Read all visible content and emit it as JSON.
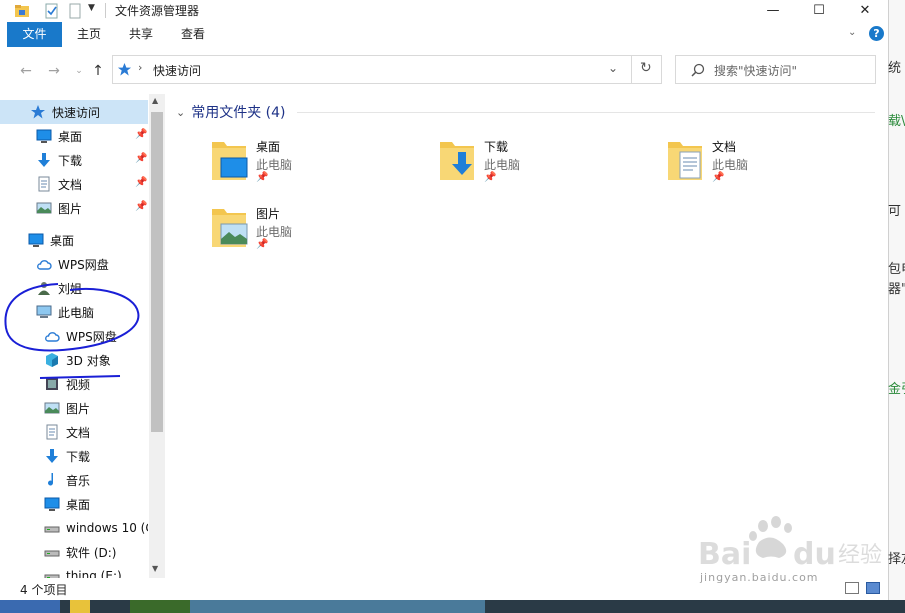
{
  "window": {
    "title": "文件资源管理器"
  },
  "ribbon": {
    "tabs": [
      "文件",
      "主页",
      "共享",
      "查看"
    ]
  },
  "address": {
    "location": "快速访问",
    "search_placeholder": "搜索\"快速访问\""
  },
  "nav": {
    "items": [
      {
        "label": "快速访问",
        "icon": "star-icon",
        "pinned": false
      },
      {
        "label": "桌面",
        "icon": "desktop-icon",
        "pinned": true
      },
      {
        "label": "下载",
        "icon": "download-icon",
        "pinned": true
      },
      {
        "label": "文档",
        "icon": "document-icon",
        "pinned": true
      },
      {
        "label": "图片",
        "icon": "picture-icon",
        "pinned": true
      },
      {
        "label": "桌面",
        "icon": "desktop-icon",
        "pinned": false
      },
      {
        "label": "WPS网盘",
        "icon": "cloud-icon",
        "pinned": false
      },
      {
        "label": "刘姐",
        "icon": "user-icon",
        "pinned": false
      },
      {
        "label": "此电脑",
        "icon": "computer-icon",
        "pinned": false
      },
      {
        "label": "WPS网盘",
        "icon": "cloud-icon",
        "pinned": false
      },
      {
        "label": "3D 对象",
        "icon": "cube-icon",
        "pinned": false
      },
      {
        "label": "视频",
        "icon": "video-icon",
        "pinned": false
      },
      {
        "label": "图片",
        "icon": "picture-icon",
        "pinned": false
      },
      {
        "label": "文档",
        "icon": "document-icon",
        "pinned": false
      },
      {
        "label": "下载",
        "icon": "download-icon",
        "pinned": false
      },
      {
        "label": "音乐",
        "icon": "music-icon",
        "pinned": false
      },
      {
        "label": "桌面",
        "icon": "desktop-icon",
        "pinned": false
      },
      {
        "label": "windows 10 (C",
        "icon": "drive-icon",
        "pinned": false
      },
      {
        "label": "软件 (D:)",
        "icon": "drive-icon",
        "pinned": false
      },
      {
        "label": "thing (E:)",
        "icon": "drive-icon",
        "pinned": false
      }
    ]
  },
  "content": {
    "group_title": "常用文件夹 (4)",
    "folders": [
      {
        "name": "桌面",
        "location": "此电脑",
        "icon": "desktop-folder-icon"
      },
      {
        "name": "下载",
        "location": "此电脑",
        "icon": "download-folder-icon"
      },
      {
        "name": "文档",
        "location": "此电脑",
        "icon": "document-folder-icon"
      },
      {
        "name": "图片",
        "location": "此电脑",
        "icon": "picture-folder-icon"
      }
    ]
  },
  "status": {
    "count": "4 个项目"
  },
  "background": {
    "fragments": [
      "统",
      "载\\",
      "可",
      "包电",
      "器\"",
      "金引",
      "择左"
    ],
    "watermark_text": "jingyan.baidu.com"
  },
  "colors": {
    "file_tab": "#1979ca",
    "accent_blue": "#1e3287",
    "folder_yellow": "#f3c64f",
    "annotation": "#1a1fd6"
  }
}
